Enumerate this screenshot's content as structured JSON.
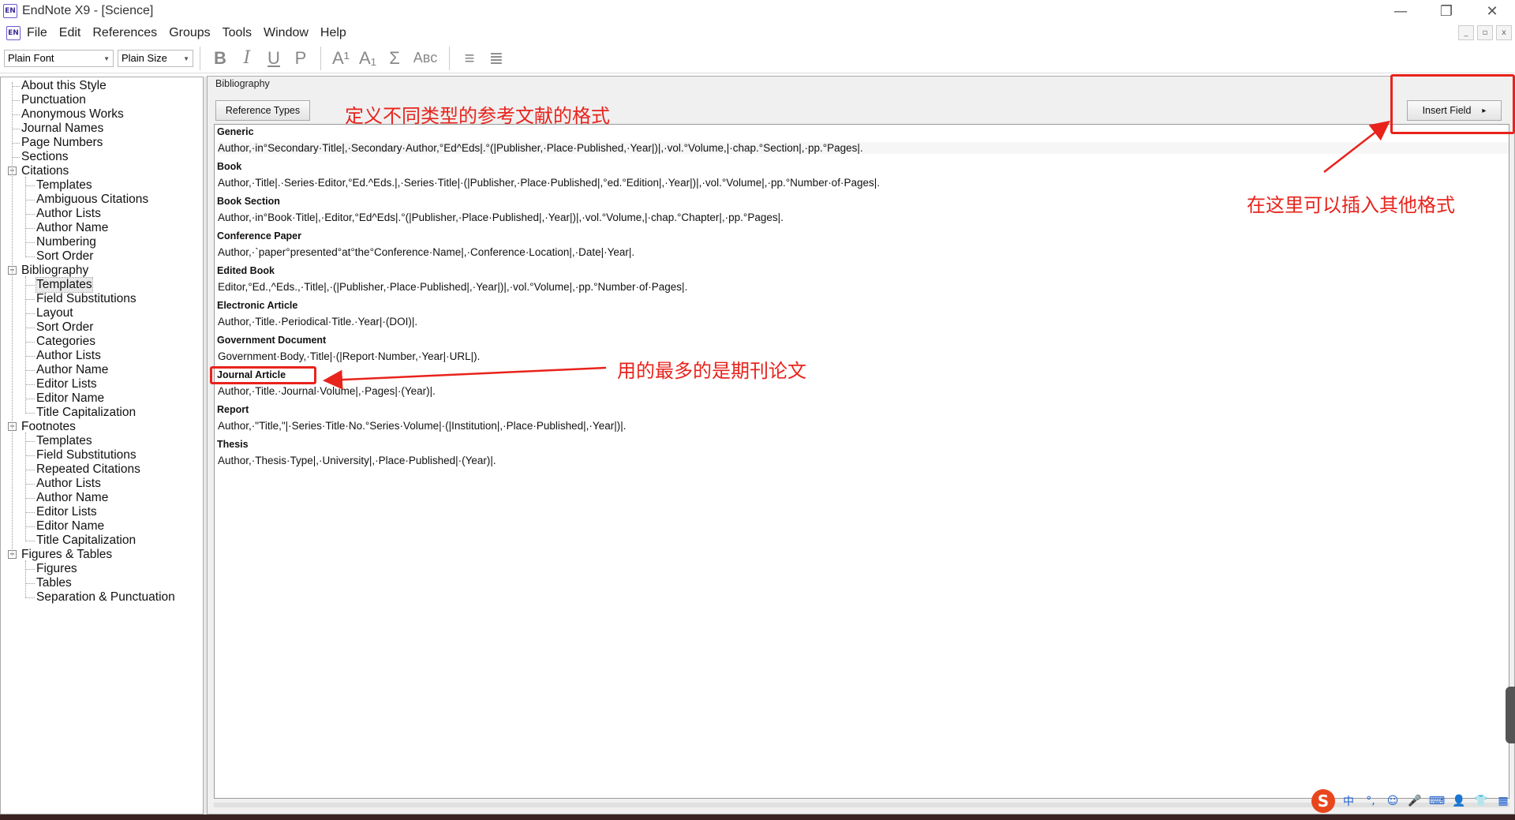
{
  "window": {
    "app_icon": "EN",
    "title": "EndNote X9 - [Science]",
    "controls": [
      "—",
      "❐",
      "✕"
    ]
  },
  "menubar": {
    "items": [
      "File",
      "Edit",
      "References",
      "Groups",
      "Tools",
      "Window",
      "Help"
    ],
    "mdi_controls": [
      "_",
      "▫",
      "x"
    ]
  },
  "toolbar": {
    "font": "Plain Font",
    "size": "Plain Size",
    "buttons": [
      {
        "label": "B",
        "name": "bold"
      },
      {
        "label": "I",
        "name": "italic"
      },
      {
        "label": "U",
        "name": "underline"
      },
      {
        "label": "P",
        "name": "plain"
      },
      {
        "label": "A¹",
        "name": "superscript"
      },
      {
        "label": "A₁",
        "name": "subscript"
      },
      {
        "label": "Σ",
        "name": "symbol"
      },
      {
        "label": "Aʙᴄ",
        "name": "small-caps"
      },
      {
        "label": "≡",
        "name": "align-left"
      },
      {
        "label": "≣",
        "name": "justify"
      }
    ]
  },
  "tree": {
    "items": [
      {
        "label": "About this Style",
        "level": 0
      },
      {
        "label": "Punctuation",
        "level": 0
      },
      {
        "label": "Anonymous Works",
        "level": 0
      },
      {
        "label": "Journal Names",
        "level": 0
      },
      {
        "label": "Page Numbers",
        "level": 0
      },
      {
        "label": "Sections",
        "level": 0
      },
      {
        "label": "Citations",
        "level": 0,
        "expander": "−"
      },
      {
        "label": "Templates",
        "level": 1
      },
      {
        "label": "Ambiguous Citations",
        "level": 1
      },
      {
        "label": "Author Lists",
        "level": 1
      },
      {
        "label": "Author Name",
        "level": 1
      },
      {
        "label": "Numbering",
        "level": 1
      },
      {
        "label": "Sort Order",
        "level": 1
      },
      {
        "label": "Bibliography",
        "level": 0,
        "expander": "−"
      },
      {
        "label": "Templates",
        "level": 1,
        "selected": true
      },
      {
        "label": "Field Substitutions",
        "level": 1
      },
      {
        "label": "Layout",
        "level": 1
      },
      {
        "label": "Sort Order",
        "level": 1
      },
      {
        "label": "Categories",
        "level": 1
      },
      {
        "label": "Author Lists",
        "level": 1
      },
      {
        "label": "Author Name",
        "level": 1
      },
      {
        "label": "Editor Lists",
        "level": 1
      },
      {
        "label": "Editor Name",
        "level": 1
      },
      {
        "label": "Title Capitalization",
        "level": 1
      },
      {
        "label": "Footnotes",
        "level": 0,
        "expander": "−"
      },
      {
        "label": "Templates",
        "level": 1
      },
      {
        "label": "Field Substitutions",
        "level": 1
      },
      {
        "label": "Repeated Citations",
        "level": 1
      },
      {
        "label": "Author Lists",
        "level": 1
      },
      {
        "label": "Author Name",
        "level": 1
      },
      {
        "label": "Editor Lists",
        "level": 1
      },
      {
        "label": "Editor Name",
        "level": 1
      },
      {
        "label": "Title Capitalization",
        "level": 1
      },
      {
        "label": "Figures & Tables",
        "level": 0,
        "expander": "−"
      },
      {
        "label": "Figures",
        "level": 1
      },
      {
        "label": "Tables",
        "level": 1
      },
      {
        "label": "Separation & Punctuation",
        "level": 1
      }
    ]
  },
  "panel": {
    "caption": "Bibliography",
    "reference_types_button": "Reference Types",
    "insert_field_button": "Insert Field",
    "insert_field_arrow": "▸",
    "references": [
      {
        "name": "Generic",
        "template": "Author,·in°Secondary·Title|,·Secondary·Author,°Ed^Eds|.°(|Publisher,·Place·Published,·Year|)|,·vol.°Volume,|·chap.°Section|,·pp.°Pages|."
      },
      {
        "name": "Book",
        "template": "Author,·Title|.·Series·Editor,°Ed.^Eds.|,·Series·Title|·(|Publisher,·Place·Published|,°ed.°Edition|,·Year|)|,·vol.°Volume|,·pp.°Number·of·Pages|."
      },
      {
        "name": "Book Section",
        "template": "Author,·in°Book·Title|,·Editor,°Ed^Eds|.°(|Publisher,·Place·Published|,·Year|)|,·vol.°Volume,|·chap.°Chapter|,·pp.°Pages|."
      },
      {
        "name": "Conference Paper",
        "template": "Author,·`paper°presented°at°the°Conference·Name|,·Conference·Location|,·Date|·Year|."
      },
      {
        "name": "Edited Book",
        "template": "Editor,°Ed.,^Eds.,·Title|,·(|Publisher,·Place·Published|,·Year|)|,·vol.°Volume|,·pp.°Number·of·Pages|."
      },
      {
        "name": "Electronic Article",
        "template": "Author,·Title.·Periodical·Title.·Year|·(DOI)|."
      },
      {
        "name": "Government Document",
        "template": "Government·Body,·Title|·(|Report·Number,·Year|·URL|)."
      },
      {
        "name": "Journal Article",
        "template": "Author,·Title.·Journal·Volume|,·Pages|·(Year)|."
      },
      {
        "name": "Report",
        "template": "Author,·\"Title,\"|·Series·Title·No.°Series·Volume|·(|Institution|,·Place·Published|,·Year|)|."
      },
      {
        "name": "Thesis",
        "template": "Author,·Thesis·Type|,·University|,·Place·Published|·(Year)|."
      }
    ]
  },
  "annotations": {
    "types_note": "定义不同类型的参考文献的格式",
    "insert_note": "在这里可以插入其他格式",
    "journal_note": "用的最多的是期刊论文",
    "color": "#e8231c"
  },
  "tray": {
    "ime_logo": "S",
    "icons": [
      "中",
      "°,",
      "☺",
      "🎤",
      "⌨",
      "👤",
      "👕",
      "▦"
    ]
  }
}
